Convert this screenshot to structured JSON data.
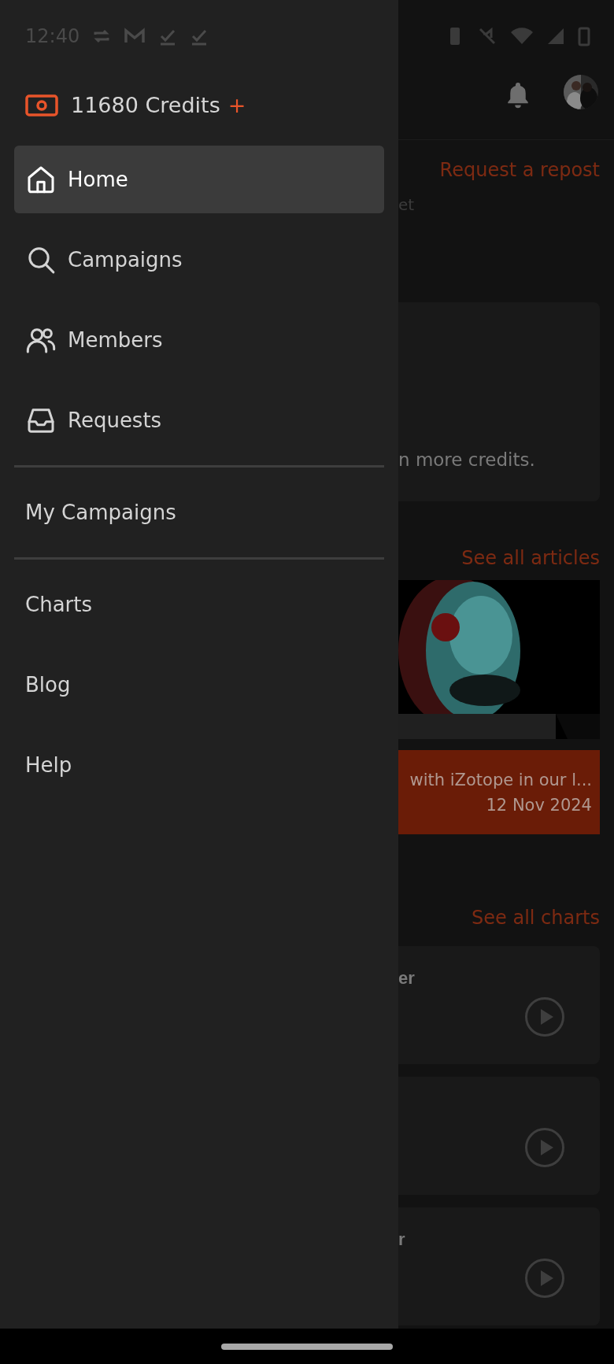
{
  "status_bar": {
    "time": "12:40"
  },
  "drawer": {
    "credits": {
      "amount": "11680 Credits",
      "add": "+"
    },
    "sections": [
      {
        "items": [
          {
            "label": "Home",
            "kind": "home",
            "selected": true
          },
          {
            "label": "Campaigns",
            "kind": "search",
            "selected": false
          },
          {
            "label": "Members",
            "kind": "members",
            "selected": false
          },
          {
            "label": "Requests",
            "kind": "inbox",
            "selected": false
          }
        ]
      },
      {
        "items": [
          {
            "label": "My Campaigns",
            "kind": "text",
            "selected": false
          }
        ]
      },
      {
        "items": [
          {
            "label": "Charts",
            "kind": "text",
            "selected": false
          },
          {
            "label": "Blog",
            "kind": "text",
            "selected": false
          },
          {
            "label": "Help",
            "kind": "text",
            "selected": false
          }
        ]
      }
    ]
  },
  "background": {
    "request_link": "Request a repost",
    "subtitle": "et",
    "card_text": "n more credits.",
    "articles_link": "See all articles",
    "article": {
      "kind": "picture",
      "title": "with iZotope in our l...",
      "date": "12 Nov 2024"
    },
    "charts_link": "See all charts",
    "chart_cards": [
      {
        "kind": "track",
        "title": "er"
      },
      {
        "kind": "track"
      },
      {
        "kind": "track",
        "title": "r"
      }
    ]
  }
}
